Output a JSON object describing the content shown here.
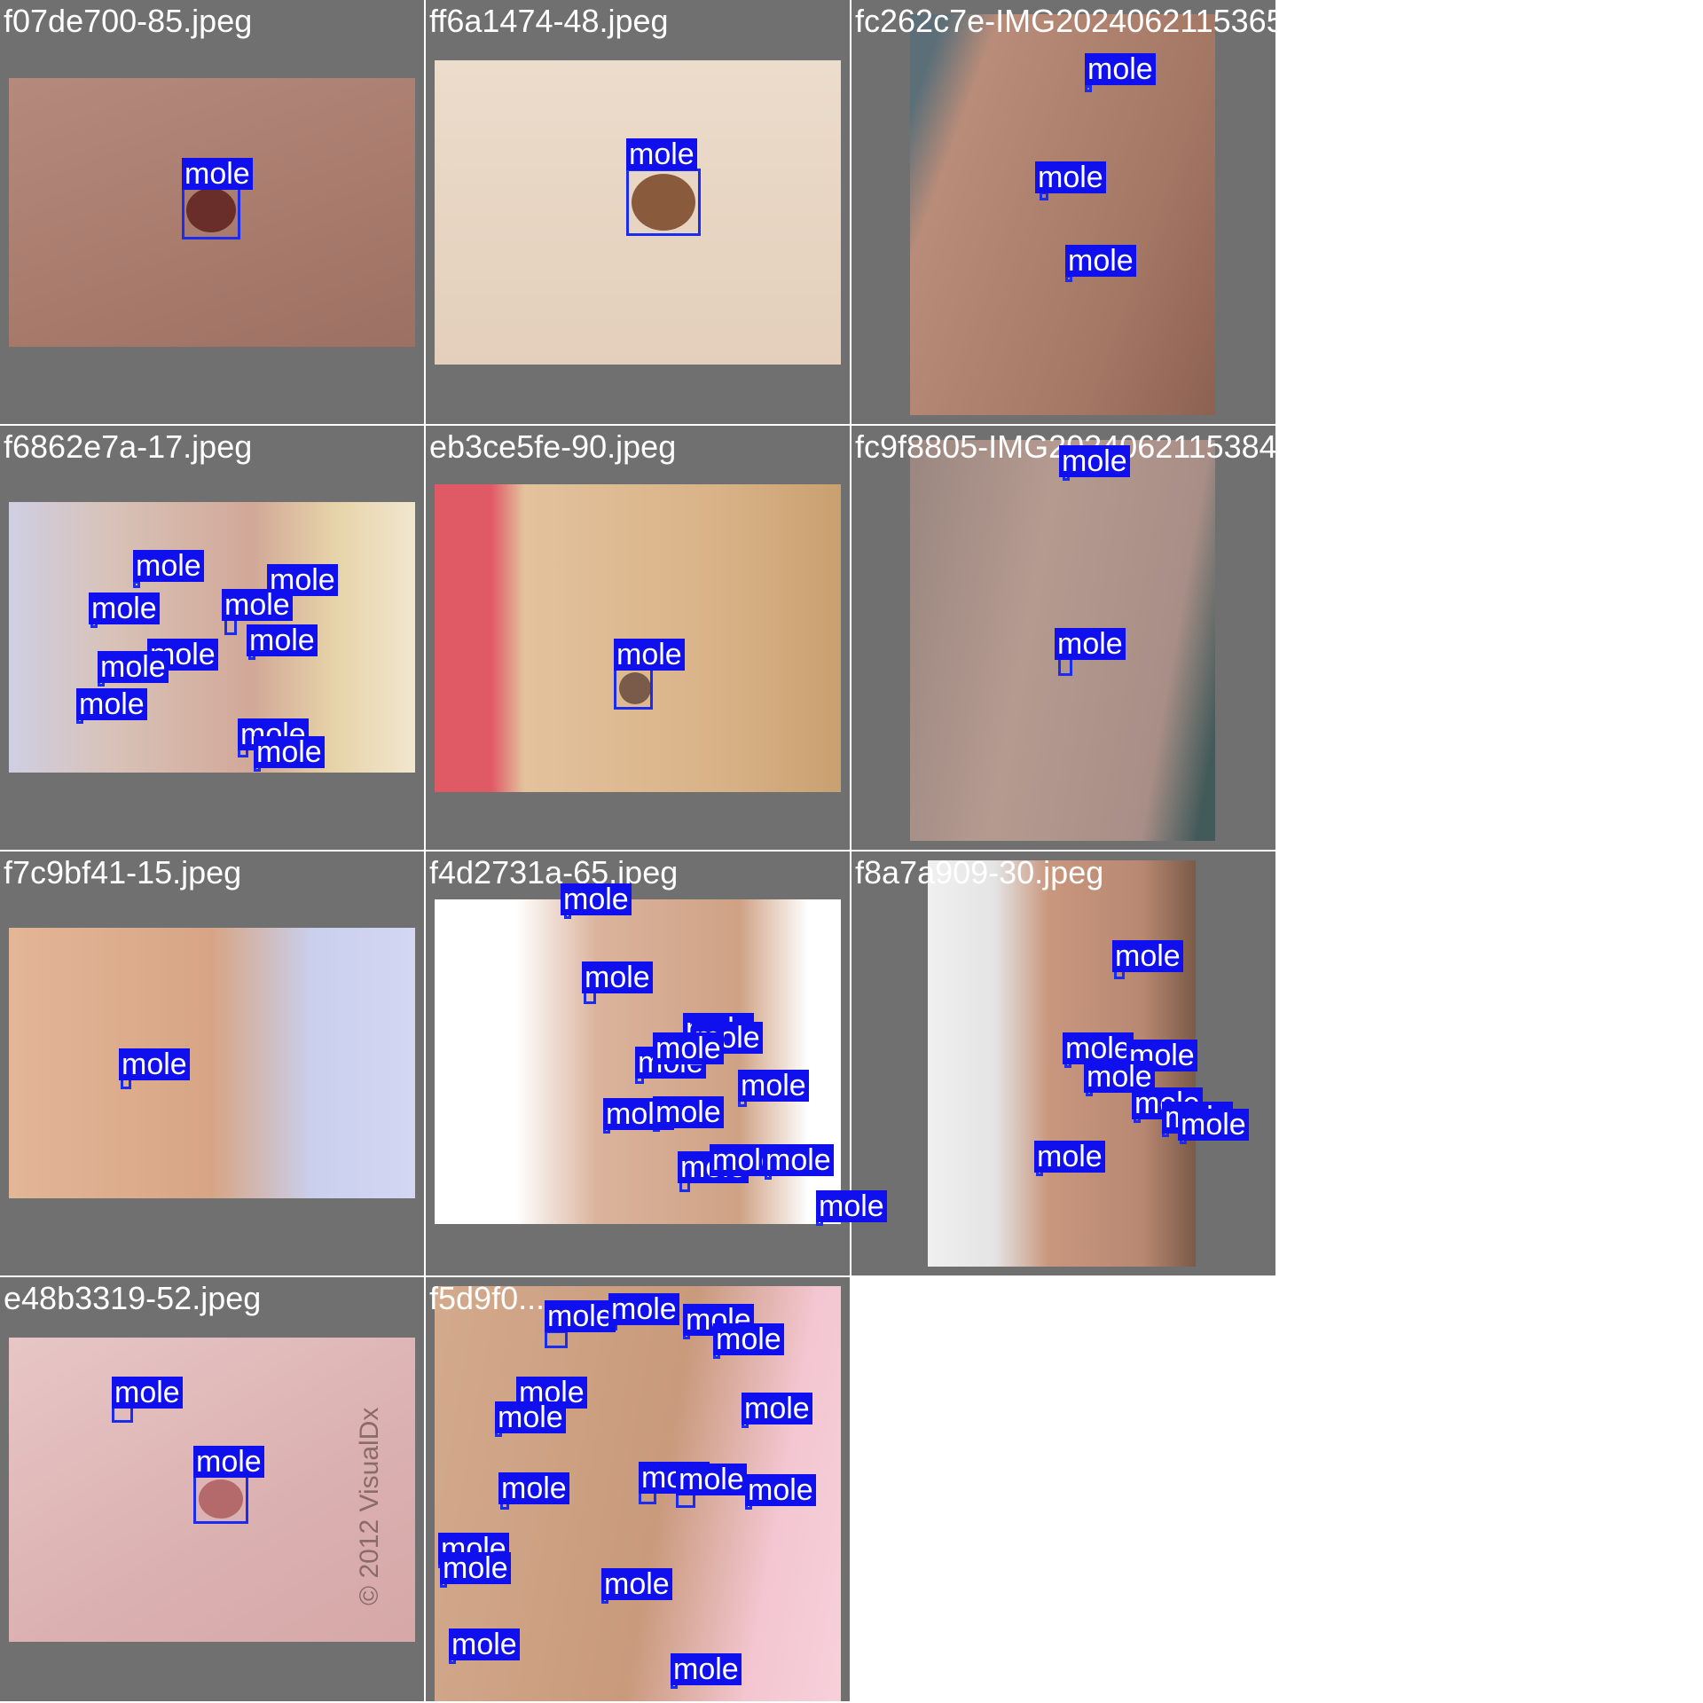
{
  "label_text": "mole",
  "colors": {
    "tile_bg": "#707070",
    "box": "#1a2cf0",
    "label_bg": "#1010ee",
    "label_text": "#ffffff"
  },
  "tiles": [
    {
      "filename": "f07de700-85.jpeg"
    },
    {
      "filename": "ff6a1474-48.jpeg"
    },
    {
      "filename": "fc262c7e-IMG20240621153651.jpg"
    },
    {
      "filename": "f6862e7a-17.jpeg"
    },
    {
      "filename": "eb3ce5fe-90.jpeg"
    },
    {
      "filename": "fc9f8805-IMG20240621153842.jpg"
    },
    {
      "filename": "f7c9bf41-15.jpeg"
    },
    {
      "filename": "f4d2731a-65.jpeg"
    },
    {
      "filename": "f8a7a909-30.jpeg"
    },
    {
      "filename": "e48b3319-52.jpeg"
    },
    {
      "filename": "f5d9f0..."
    }
  ],
  "watermarks": {
    "visualdx": "© 2012 VisualDx"
  }
}
